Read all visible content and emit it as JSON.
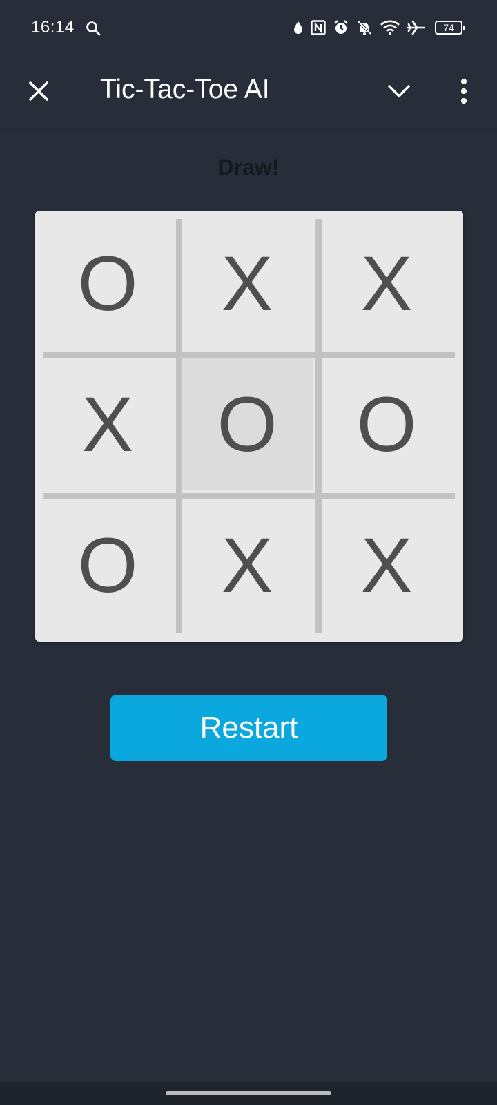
{
  "status_bar": {
    "time": "16:14",
    "battery": "74",
    "icons": [
      "search-icon",
      "water-drop-icon",
      "nfc-icon",
      "alarm-icon",
      "bell-off-icon",
      "wifi-icon",
      "airplane-icon",
      "battery-icon"
    ]
  },
  "app_bar": {
    "title": "Tic-Tac-Toe AI",
    "close_icon": "close-icon",
    "collapse_icon": "chevron-down-icon",
    "menu_icon": "more-vertical-icon"
  },
  "game": {
    "status": "Draw!",
    "board": [
      [
        "O",
        "X",
        "X"
      ],
      [
        "X",
        "O",
        "O"
      ],
      [
        "O",
        "X",
        "X"
      ]
    ]
  },
  "restart_label": "Restart",
  "colors": {
    "background": "#272e39",
    "board": "#e8e8e8",
    "grid_line": "#c2c2c2",
    "mark": "#4f4f4f",
    "accent": "#0aa8de",
    "status_text": "#15181c"
  }
}
